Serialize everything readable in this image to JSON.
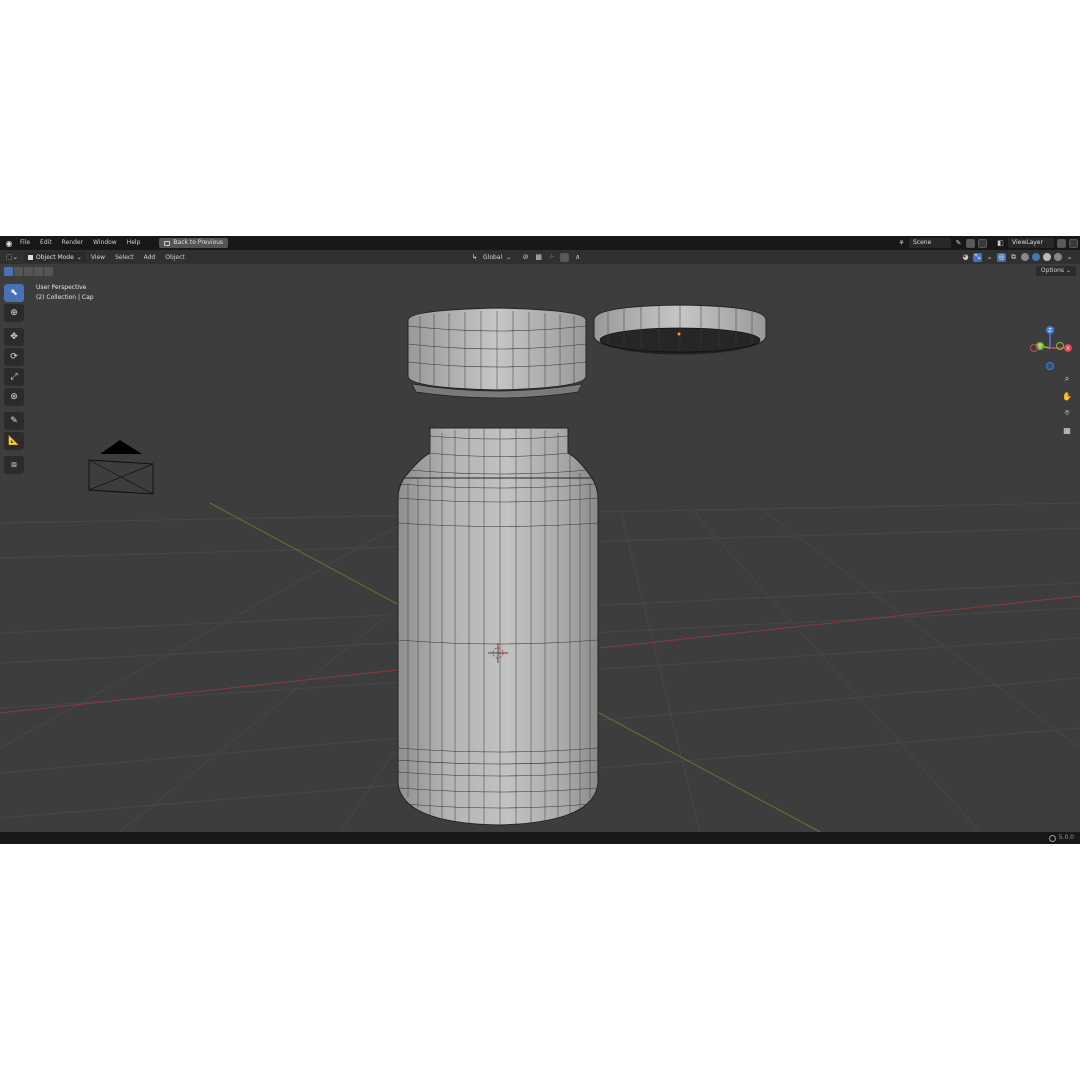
{
  "topbar": {
    "menus": [
      "File",
      "Edit",
      "Render",
      "Window",
      "Help"
    ],
    "back_button": "Back to Previous",
    "scene": "Scene",
    "view_layer": "ViewLayer"
  },
  "header": {
    "mode": "Object Mode",
    "menus": [
      "View",
      "Select",
      "Add",
      "Object"
    ],
    "transform_orientation": "Global"
  },
  "toolrow": {
    "options": "Options"
  },
  "viewport": {
    "perspective": "User Perspective",
    "collection": "(2) Collection | Cap"
  },
  "gizmo": {
    "x_label": "X",
    "y_label": "Y",
    "z_label": "Z",
    "x_color": "#d94552",
    "y_color": "#7fbf3f",
    "z_color": "#4a7fd9"
  },
  "statusbar": {
    "version": "5.0.0"
  }
}
